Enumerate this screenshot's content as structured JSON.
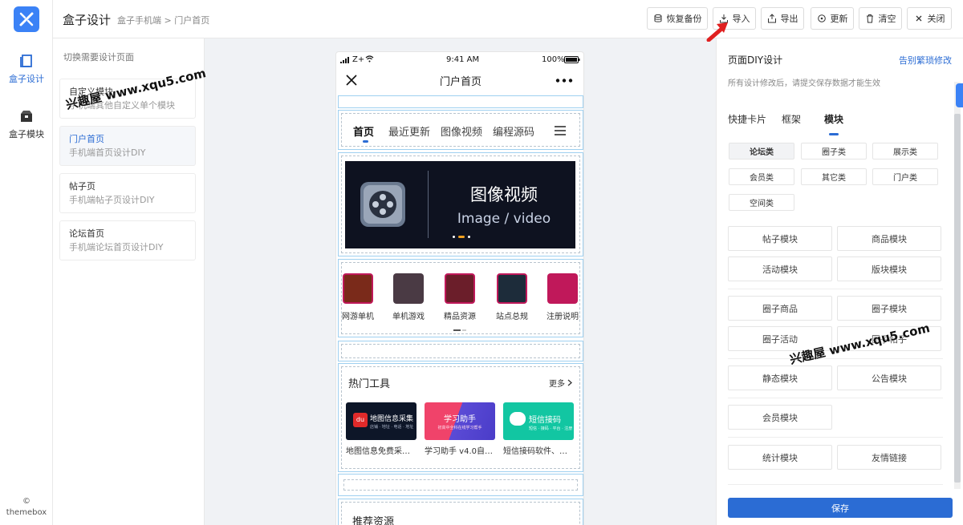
{
  "rail": {
    "items": [
      {
        "label": "盒子设计",
        "icon": "book-icon"
      },
      {
        "label": "盒子模块",
        "icon": "box-icon"
      }
    ],
    "footer_symbol": "©",
    "footer_text": "themebox"
  },
  "topbar": {
    "title": "盒子设计",
    "breadcrumb": "盒子手机端 > 门户首页",
    "buttons": [
      {
        "label": "恢复备份",
        "icon": "database-icon"
      },
      {
        "label": "导入",
        "icon": "import-icon"
      },
      {
        "label": "导出",
        "icon": "export-icon"
      },
      {
        "label": "更新",
        "icon": "refresh-icon"
      },
      {
        "label": "清空",
        "icon": "trash-icon"
      },
      {
        "label": "关闭",
        "icon": "close-icon"
      }
    ]
  },
  "pagelist": {
    "hint": "切换需要设计页面",
    "pages": [
      {
        "title": "自定义模块",
        "sub": "手机端其他自定义单个模块"
      },
      {
        "title": "门户首页",
        "sub": "手机端首页设计DIY"
      },
      {
        "title": "帖子页",
        "sub": "手机端帖子页设计DIY"
      },
      {
        "title": "论坛首页",
        "sub": "手机端论坛首页设计DIY"
      }
    ],
    "active_index": 1
  },
  "watermark": "兴趣屋 www.xqu5.com",
  "phone": {
    "status": {
      "carrier": "Z+",
      "time": "9:41 AM",
      "battery": "100%"
    },
    "title": "门户首页",
    "tabs": [
      "首页",
      "最近更新",
      "图像视频",
      "编程源码"
    ],
    "banner": {
      "title": "图像视频",
      "subtitle": "Image / video"
    },
    "icons": [
      {
        "label": "网游单机",
        "color": "#7a2a1a"
      },
      {
        "label": "单机游戏",
        "color": "#4a3a44"
      },
      {
        "label": "精品资源",
        "color": "#6b1e2a"
      },
      {
        "label": "站点总规",
        "color": "#1d2c3a"
      },
      {
        "label": "注册说明",
        "color": "#c0185a"
      }
    ],
    "hot_tools": {
      "title": "热门工具",
      "more": "更多",
      "items": [
        {
          "thumb": "地图信息采集",
          "thumb_sub": "店铺 · 地址 · 电话 · 地址",
          "badge": "du",
          "caption": "地图信息免费采…"
        },
        {
          "thumb": "学习助手",
          "thumb_sub": "初高中全科在线学习帮手",
          "caption": "学习助手 v4.0自…"
        },
        {
          "thumb": "短信接码",
          "thumb_sub": "短信 · 接码 · 平台 · 注册",
          "caption": "短信接码软件、…"
        }
      ]
    },
    "recommend": "推荐资源"
  },
  "rpanel": {
    "title": "页面DIY设计",
    "link": "告别繁琐修改",
    "sub": "所有设计修改后，请提交保存数据才能生效",
    "tabs": [
      "快捷卡片",
      "框架",
      "模块"
    ],
    "active_tab": 2,
    "categories": [
      "论坛类",
      "圈子类",
      "展示类",
      "会员类",
      "其它类",
      "门户类",
      "空间类"
    ],
    "active_category": 0,
    "modules": [
      [
        "帖子模块",
        "商品模块"
      ],
      [
        "活动模块",
        "版块模块"
      ],
      [
        "圈子商品",
        "圈子模块"
      ],
      [
        "圈子活动",
        "圈子帖子"
      ],
      [
        "静态模块",
        "公告模块"
      ],
      [
        "会员模块"
      ],
      [
        "统计模块",
        "友情链接"
      ]
    ],
    "save": "保存"
  },
  "colors": {
    "accent": "#2b6cd4",
    "logo": "#3b82f6",
    "arrow": "#e02020",
    "frame": "#9fd0f0"
  }
}
